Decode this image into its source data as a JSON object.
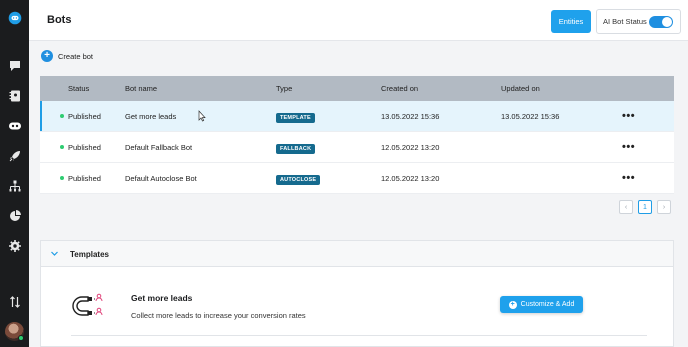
{
  "page": {
    "title": "Bots"
  },
  "header": {
    "entities_label": "Entities",
    "ai_status_label": "AI Bot Status",
    "ai_status_on": true
  },
  "actions": {
    "create_bot_label": "Create bot"
  },
  "table": {
    "columns": [
      "Status",
      "Bot name",
      "Type",
      "Created on",
      "Updated on"
    ],
    "rows": [
      {
        "status": "Published",
        "name": "Get more leads",
        "type": "TEMPLATE",
        "created": "13.05.2022 15:36",
        "updated": "13.05.2022 15:36",
        "more": "•••"
      },
      {
        "status": "Published",
        "name": "Default Fallback Bot",
        "type": "FALLBACK",
        "created": "12.05.2022 13:20",
        "updated": "",
        "more": "•••"
      },
      {
        "status": "Published",
        "name": "Default Autoclose Bot",
        "type": "AUTOCLOSE",
        "created": "12.05.2022 13:20",
        "updated": "",
        "more": "•••"
      }
    ]
  },
  "pagination": {
    "prev": "‹",
    "current": "1",
    "next": "›"
  },
  "templates": {
    "title": "Templates",
    "items": [
      {
        "name": "Get more leads",
        "description": "Collect more leads to increase your conversion rates",
        "button_label": "Customize & Add"
      }
    ]
  },
  "icons": [
    "logo-icon",
    "chat-icon",
    "contacts-icon",
    "bot-icon",
    "rocket-icon",
    "hierarchy-icon",
    "pie-chart-icon",
    "gear-icon",
    "sort-icon",
    "avatar"
  ],
  "colors": {
    "accent": "#1fa1ec",
    "sidebar": "#1b1c1e",
    "badge": "#156a8e",
    "published": "#2ecc71",
    "table_header": "#b2bac3"
  }
}
